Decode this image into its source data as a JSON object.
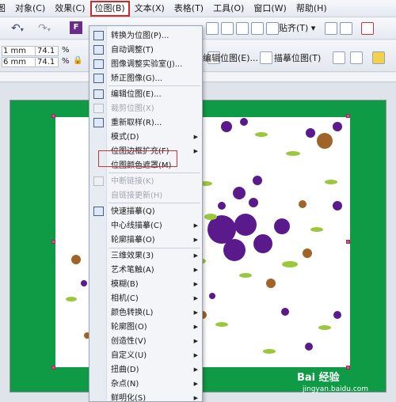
{
  "menubar": {
    "items": [
      "图",
      "对象(C)",
      "效果(C)",
      "位图(B)",
      "文本(X)",
      "表格(T)",
      "工具(O)",
      "窗口(W)",
      "帮助(H)"
    ]
  },
  "toolbar": {
    "snap_label": "贴齐(T)"
  },
  "propbar": {
    "dim1": "1 mm",
    "dim2": "6 mm",
    "pct1": "74.1",
    "pct2": "74.1",
    "pct_sign": "%",
    "edit_bitmap": "编辑位图(E)...",
    "trace_bitmap": "描摹位图(T)"
  },
  "menu": {
    "items": [
      {
        "label": "转换为位图(P)...",
        "disabled": false,
        "arrow": false,
        "icon": "convert-bitmap-icon"
      },
      {
        "label": "自动调整(T)",
        "disabled": false,
        "arrow": false,
        "icon": "auto-adjust-icon"
      },
      {
        "label": "图像调整实验室(J)...",
        "disabled": false,
        "arrow": false,
        "icon": "image-lab-icon"
      },
      {
        "label": "矫正图像(G)...",
        "disabled": false,
        "arrow": false,
        "icon": "straighten-icon"
      },
      {
        "label": "编辑位图(E)...",
        "disabled": false,
        "arrow": false,
        "icon": "edit-bitmap-icon"
      },
      {
        "label": "裁剪位图(X)",
        "disabled": true,
        "arrow": false,
        "icon": "crop-icon"
      },
      {
        "label": "重新取样(R)...",
        "disabled": false,
        "arrow": false,
        "icon": "resample-icon"
      },
      {
        "label": "模式(D)",
        "disabled": false,
        "arrow": true,
        "icon": ""
      },
      {
        "label": "位图边框扩充(F)",
        "disabled": false,
        "arrow": true,
        "icon": ""
      },
      {
        "label": "位图颜色遮罩(M)",
        "disabled": false,
        "arrow": false,
        "icon": ""
      },
      {
        "label": "中断链接(K)",
        "disabled": true,
        "arrow": false,
        "icon": "break-link-icon"
      },
      {
        "label": "自链接更新(H)",
        "disabled": true,
        "arrow": false,
        "icon": ""
      },
      {
        "label": "快速描摹(Q)",
        "disabled": false,
        "arrow": false,
        "icon": "quick-trace-icon"
      },
      {
        "label": "中心线描摹(C)",
        "disabled": false,
        "arrow": true,
        "icon": ""
      },
      {
        "label": "轮廓描摹(O)",
        "disabled": false,
        "arrow": true,
        "icon": ""
      },
      {
        "label": "三维效果(3)",
        "disabled": false,
        "arrow": true,
        "icon": ""
      },
      {
        "label": "艺术笔触(A)",
        "disabled": false,
        "arrow": true,
        "icon": ""
      },
      {
        "label": "模糊(B)",
        "disabled": false,
        "arrow": true,
        "icon": ""
      },
      {
        "label": "相机(C)",
        "disabled": false,
        "arrow": true,
        "icon": ""
      },
      {
        "label": "颜色转换(L)",
        "disabled": false,
        "arrow": true,
        "icon": ""
      },
      {
        "label": "轮廓图(O)",
        "disabled": false,
        "arrow": true,
        "icon": ""
      },
      {
        "label": "创造性(V)",
        "disabled": false,
        "arrow": true,
        "icon": ""
      },
      {
        "label": "自定义(U)",
        "disabled": false,
        "arrow": true,
        "icon": ""
      },
      {
        "label": "扭曲(D)",
        "disabled": false,
        "arrow": true,
        "icon": ""
      },
      {
        "label": "杂点(N)",
        "disabled": false,
        "arrow": true,
        "icon": ""
      },
      {
        "label": "鲜明化(S)",
        "disabled": false,
        "arrow": true,
        "icon": ""
      },
      {
        "label": "底纹(T)",
        "disabled": false,
        "arrow": true,
        "icon": ""
      }
    ]
  },
  "watermark": {
    "brand": "Bai 经验",
    "url": "jingyan.baidu.com"
  },
  "colors": {
    "background_green": "#0f9a46",
    "highlight_red": "#c8353a",
    "flower_purple": "#5b1a8c"
  }
}
